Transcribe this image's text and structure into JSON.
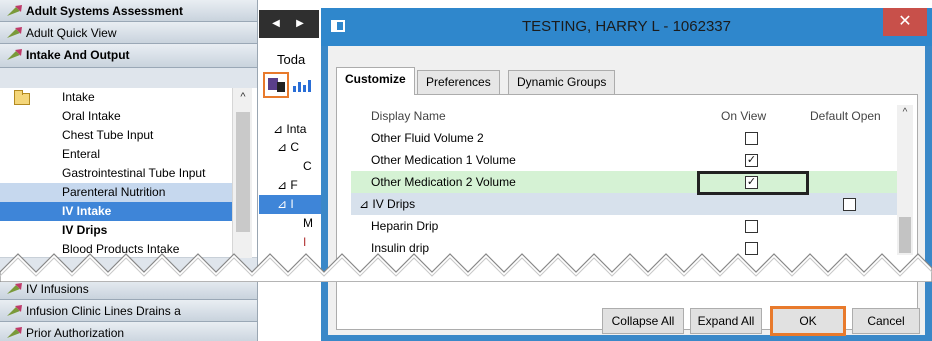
{
  "nav": {
    "bands_top": [
      {
        "label": "Adult Systems Assessment",
        "bold": true
      },
      {
        "label": "Adult Quick View",
        "bold": false
      },
      {
        "label": "Intake And Output",
        "bold": true
      }
    ],
    "section_items": [
      {
        "label": "Intake",
        "style": "plain"
      },
      {
        "label": "Oral Intake",
        "style": "plain"
      },
      {
        "label": "Chest Tube Input",
        "style": "plain"
      },
      {
        "label": "Enteral",
        "style": "plain"
      },
      {
        "label": "Gastrointestinal Tube Input",
        "style": "plain"
      },
      {
        "label": "Parenteral Nutrition",
        "style": "highlight"
      },
      {
        "label": "IV Intake",
        "style": "selected"
      },
      {
        "label": "IV Drips",
        "style": "bold"
      },
      {
        "label": "Blood Products Intake",
        "style": "plain"
      }
    ],
    "bands_bottom": [
      {
        "label": "IV Infusions",
        "bold": false
      },
      {
        "label": "Infusion Clinic Lines Drains a",
        "bold": false
      },
      {
        "label": "Prior Authorization",
        "bold": false
      }
    ]
  },
  "middle": {
    "today_label": "Toda",
    "rows": [
      "⊿ Inta",
      "⊿ C",
      "C",
      "⊿ F",
      "⊿ I",
      "M",
      "I"
    ]
  },
  "dialog": {
    "title": "TESTING, HARRY L - 1062337",
    "close_glyph": "✕",
    "tabs": [
      "Customize",
      "Preferences",
      "Dynamic Groups"
    ],
    "active_tab": "Customize",
    "columns": {
      "name": "Display Name",
      "on_view": "On View",
      "default_open": "Default Open"
    },
    "rows": [
      {
        "label": "Other Fluid Volume 2",
        "type": "item",
        "on_view": false
      },
      {
        "label": "Other Medication 1 Volume",
        "type": "item",
        "on_view": true
      },
      {
        "label": "Other Medication 2 Volume",
        "type": "item",
        "on_view": true,
        "highlight": true
      },
      {
        "label": "⊿ IV Drips",
        "type": "group",
        "default_open": false
      },
      {
        "label": "Heparin Drip",
        "type": "item",
        "on_view": false
      },
      {
        "label": "Insulin drip",
        "type": "item",
        "on_view": false
      }
    ],
    "buttons": {
      "collapse_all": "Collapse All",
      "expand_all": "Expand All",
      "ok": "OK",
      "cancel": "Cancel"
    },
    "check_glyph": "✓"
  },
  "colors": {
    "accent_orange": "#e87a2c",
    "title_blue": "#2f87cc",
    "selected_blue": "#3e85d8",
    "row_green": "#d5f2d4"
  }
}
